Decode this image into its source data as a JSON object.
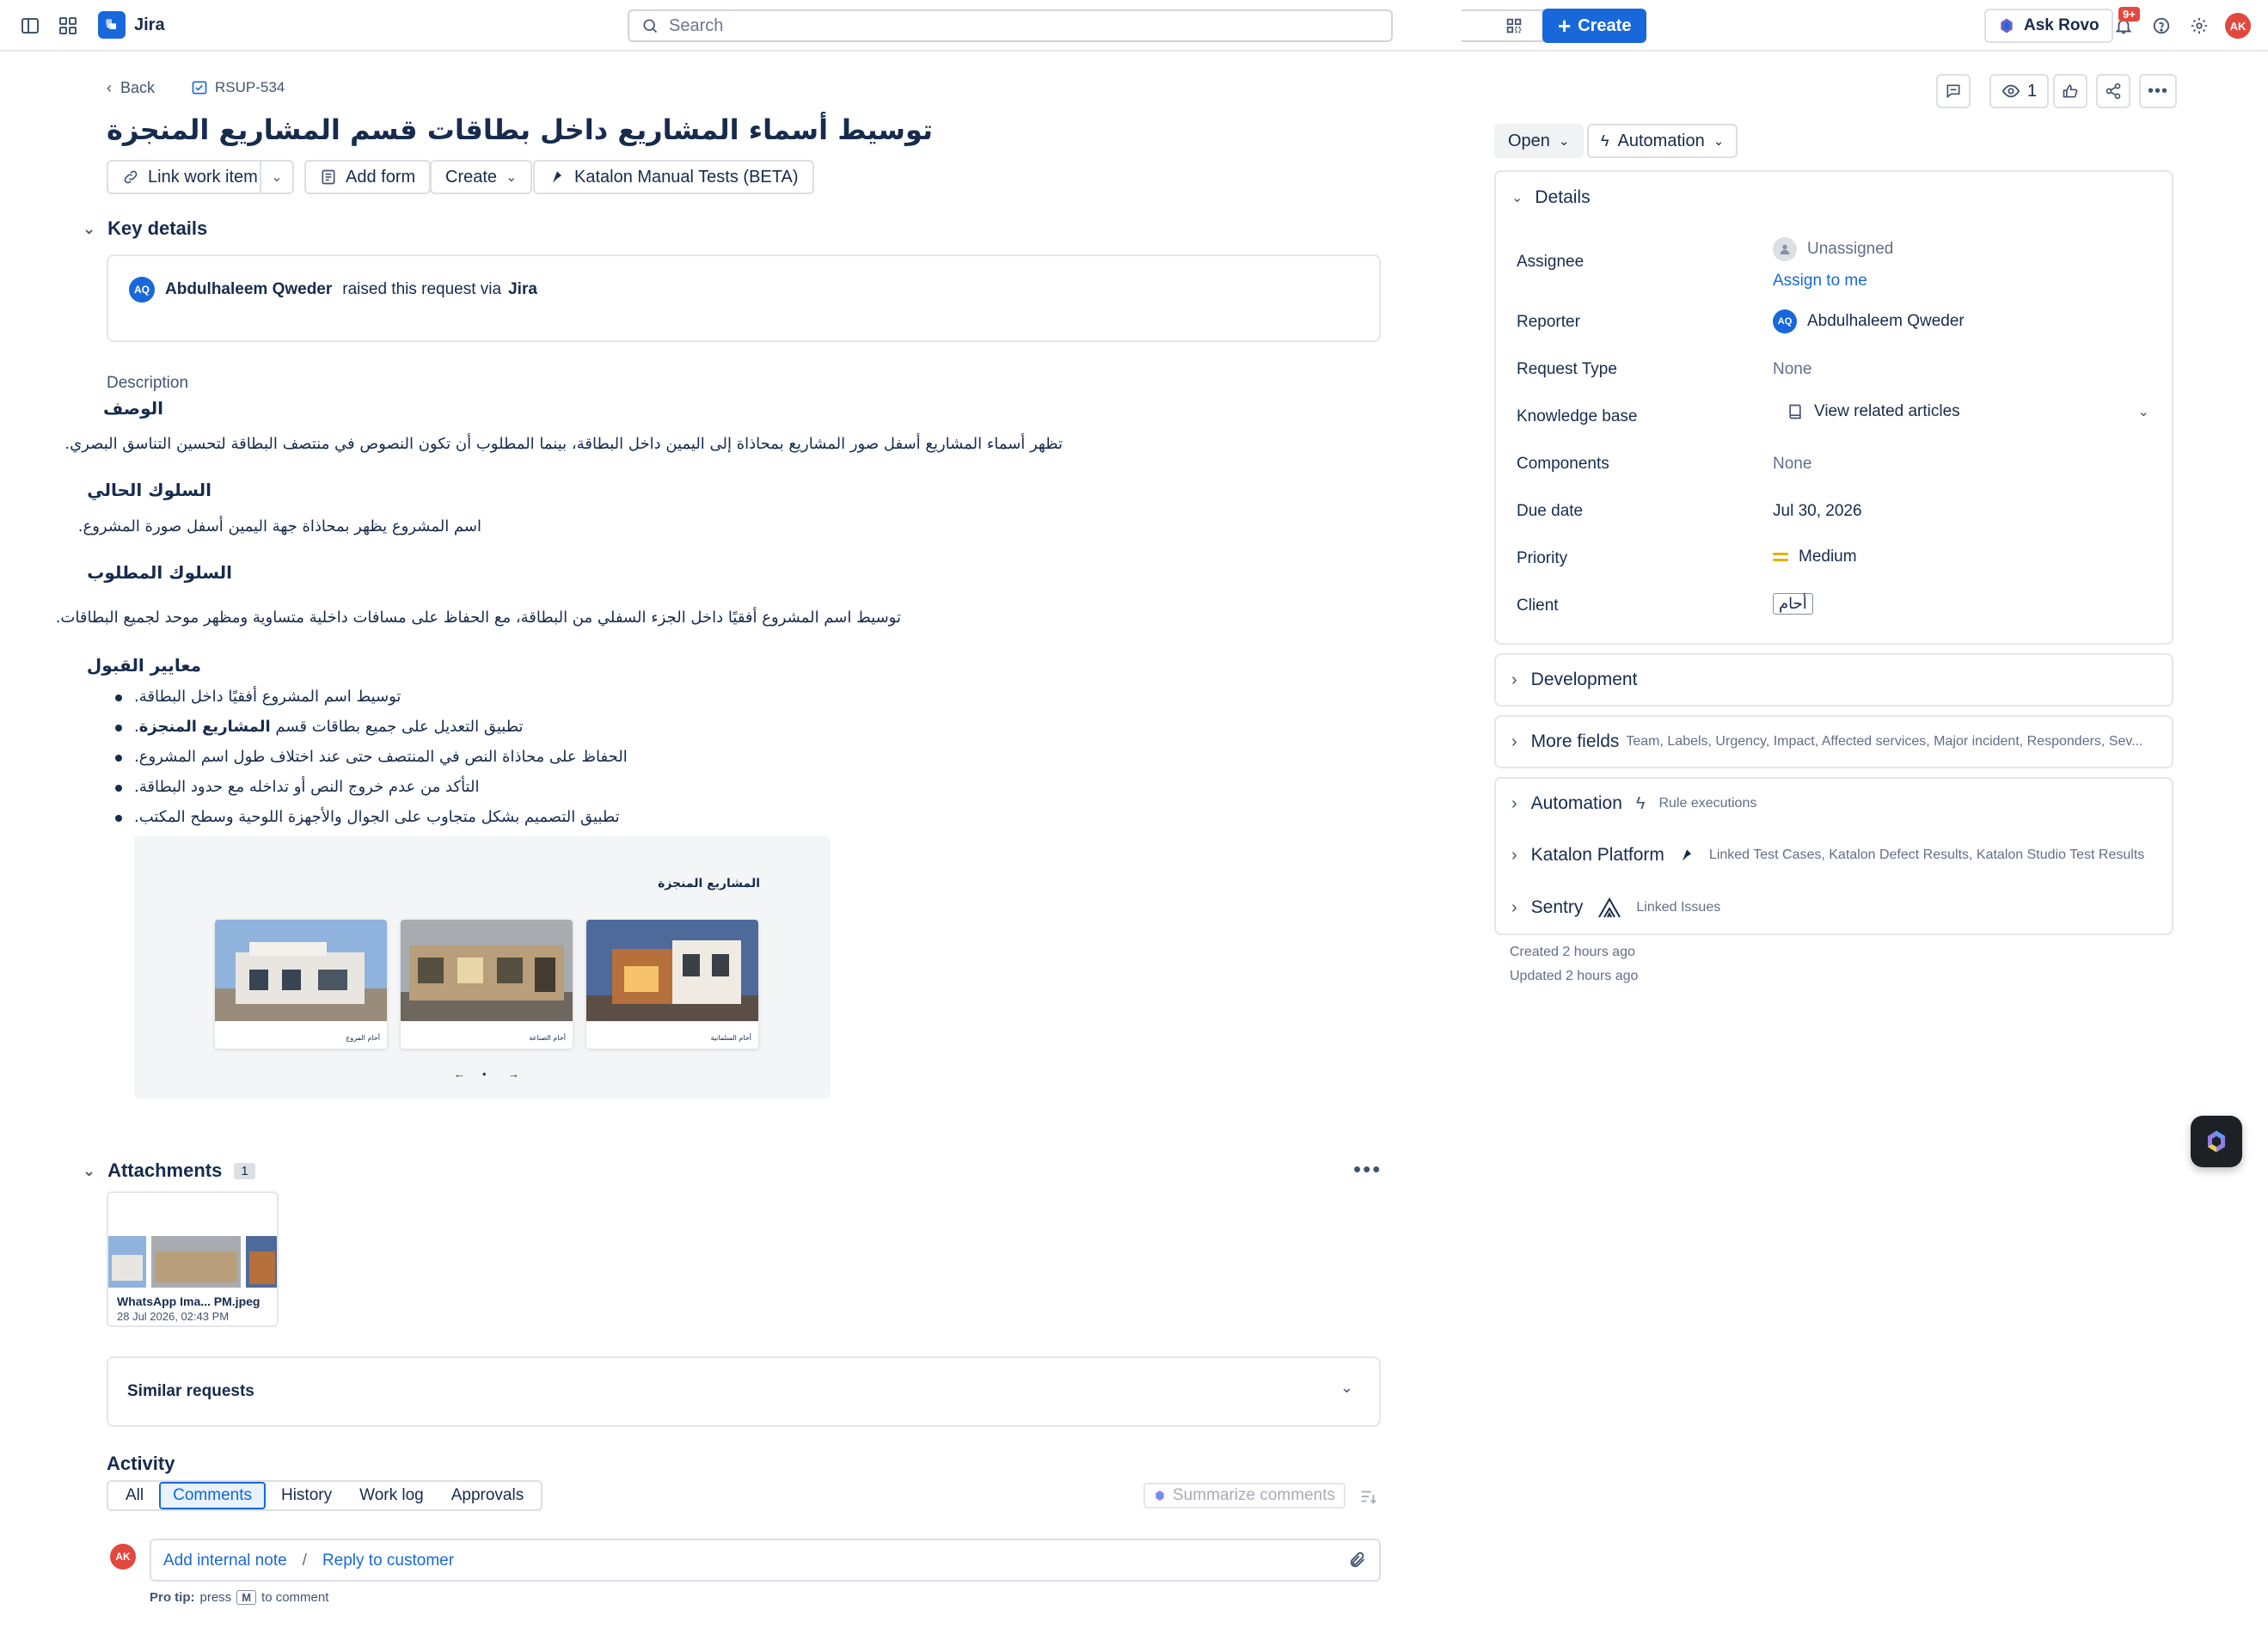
{
  "topbar": {
    "app_name": "Jira",
    "search_placeholder": "Search",
    "create_label": "Create",
    "ask_rovo_label": "Ask Rovo",
    "notification_badge": "9+",
    "user_initials": "AK"
  },
  "issue": {
    "back_label": "Back",
    "key": "RSUP-534",
    "title": "توسيط أسماء المشاريع داخل بطاقات قسم المشاريع المنجزة",
    "actions": {
      "link_work_item": "Link work item",
      "add_form": "Add form",
      "create": "Create",
      "katalon": "Katalon Manual Tests (BETA)"
    }
  },
  "key_details": {
    "heading": "Key details",
    "reporter_initials": "AQ",
    "reporter_name": "Abdulhaleem Qweder",
    "raised_text": "raised this request via",
    "raised_via": "Jira"
  },
  "description": {
    "label": "Description",
    "h1": "الوصف",
    "p1": "تظهر أسماء المشاريع أسفل صور المشاريع بمحاذاة إلى اليمين داخل البطاقة، بينما المطلوب أن تكون النصوص في منتصف البطاقة لتحسين التناسق البصري.",
    "h2": "السلوك الحالي",
    "p2": "اسم المشروع يظهر بمحاذاة جهة اليمين أسفل صورة المشروع.",
    "h3": "السلوك المطلوب",
    "p3": "توسيط اسم المشروع أفقيًا داخل الجزء السفلي من البطاقة، مع الحفاظ على مسافات داخلية متساوية ومظهر موحد لجميع البطاقات.",
    "h4": "معايير القبول",
    "bullets": [
      "توسيط اسم المشروع أفقيًا داخل البطاقة.",
      "تطبيق التعديل على جميع بطاقات قسم المشاريع المنجزة.",
      "الحفاظ على محاذاة النص في المنتصف حتى عند اختلاف طول اسم المشروع.",
      "التأكد من عدم خروج النص أو تداخله مع حدود البطاقة.",
      "تطبيق التصميم بشكل متجاوب على الجوال والأجهزة اللوحية وسطح المكتب."
    ],
    "bullet2_plain": "تطبيق التعديل على جميع بطاقات قسم",
    "bullet2_bold": "المشاريع المنجزة",
    "embed": {
      "section_title": "المشاريع المنجزة",
      "cards": [
        "أحام السلمانية",
        "أحام الصناعة",
        "أحام المروج"
      ],
      "pager": [
        "←",
        "•",
        "→"
      ]
    }
  },
  "attachments": {
    "heading": "Attachments",
    "count": "1",
    "file_name": "WhatsApp Ima... PM.jpeg",
    "file_date": "28 Jul 2026, 02:43 PM"
  },
  "similar_requests": {
    "label": "Similar requests"
  },
  "activity": {
    "heading": "Activity",
    "tabs": [
      "All",
      "Comments",
      "History",
      "Work log",
      "Approvals"
    ],
    "summarize": "Summarize comments",
    "add_internal_note": "Add internal note",
    "separator": "/",
    "reply_to_customer": "Reply to customer",
    "pro_tip_label": "Pro tip:",
    "pro_tip_press": "press",
    "pro_tip_key": "M",
    "pro_tip_rest": "to comment",
    "user_initials": "AK"
  },
  "sidebar": {
    "watch_count": "1",
    "status": "Open",
    "automation_btn": "Automation",
    "details_heading": "Details",
    "fields": {
      "assignee_label": "Assignee",
      "assignee_value": "Unassigned",
      "assign_to_me": "Assign to me",
      "reporter_label": "Reporter",
      "reporter_initials": "AQ",
      "reporter_value": "Abdulhaleem Qweder",
      "request_type_label": "Request Type",
      "request_type_value": "None",
      "knowledge_base_label": "Knowledge base",
      "knowledge_base_value": "View related articles",
      "components_label": "Components",
      "components_value": "None",
      "due_date_label": "Due date",
      "due_date_value": "Jul 30, 2026",
      "priority_label": "Priority",
      "priority_value": "Medium",
      "client_label": "Client",
      "client_value": "أحام"
    },
    "development": "Development",
    "more_fields": "More fields",
    "more_fields_sub": "Team, Labels, Urgency, Impact, Affected services, Major incident, Responders, Sev...",
    "automation": "Automation",
    "automation_sub": "Rule executions",
    "katalon": "Katalon Platform",
    "katalon_sub": "Linked Test Cases, Katalon Defect Results, Katalon Studio Test Results",
    "sentry": "Sentry",
    "sentry_sub": "Linked Issues",
    "created": "Created 2 hours ago",
    "updated": "Updated 2 hours ago"
  },
  "colors": {
    "brand_blue": "#1868db",
    "avatar_aq": "#1868db",
    "avatar_ak": "#e2483d",
    "priority_medium": "#e2b203",
    "badge_red": "#e2483d"
  }
}
